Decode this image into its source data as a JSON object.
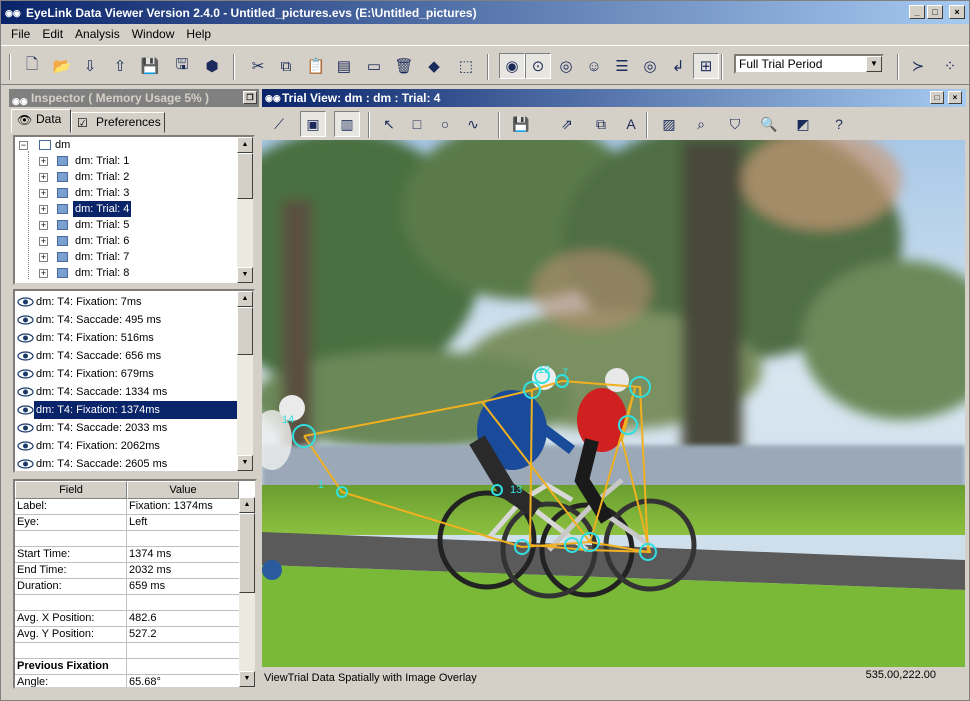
{
  "window": {
    "title": "EyeLink Data Viewer Version 2.4.0 - Untitled_pictures.evs (E:\\Untitled_pictures)",
    "icon": "eye-icon"
  },
  "menu": [
    "File",
    "Edit",
    "Analysis",
    "Window",
    "Help"
  ],
  "toolbar": {
    "period_select": "Full Trial Period",
    "buttons": [
      "new-document-icon",
      "open-folder-icon",
      "import-icon",
      "export-icon",
      "save-icon",
      "save-all-icon",
      "package-icon",
      "cut-icon",
      "copy-icon",
      "paste-icon",
      "clipboard-icon",
      "drive-icon",
      "delete-icon",
      "eraser-icon",
      "select-region-icon",
      "eye-icon",
      "eye-path-icon",
      "eye-closed-icon",
      "eye-person-icon",
      "report-icon",
      "target-icon",
      "input-icon",
      "grid-icon",
      "terminal-icon",
      "scatter-icon"
    ]
  },
  "inspector": {
    "title": "Inspector ( Memory Usage 5% )",
    "tabs": {
      "data": "Data",
      "preferences": "Preferences"
    },
    "tree": {
      "root": "dm",
      "items": [
        "dm: Trial: 1",
        "dm: Trial: 2",
        "dm: Trial: 3",
        "dm: Trial: 4",
        "dm: Trial: 5",
        "dm: Trial: 6",
        "dm: Trial: 7",
        "dm: Trial: 8"
      ],
      "selected": 3
    },
    "events": {
      "items": [
        "dm: T4: Fixation: 7ms",
        "dm: T4: Saccade: 495 ms",
        "dm: T4: Fixation: 516ms",
        "dm: T4: Saccade: 656 ms",
        "dm: T4: Fixation: 679ms",
        "dm: T4: Saccade: 1334 ms",
        "dm: T4: Fixation: 1374ms",
        "dm: T4: Saccade: 2033 ms",
        "dm: T4: Fixation: 2062ms",
        "dm: T4: Saccade: 2605 ms"
      ],
      "selected": 6
    },
    "properties": {
      "headers": {
        "field": "Field",
        "value": "Value"
      },
      "rows": [
        {
          "k": "Label:",
          "v": "Fixation: 1374ms"
        },
        {
          "k": "Eye:",
          "v": "Left"
        },
        {
          "k": "",
          "v": ""
        },
        {
          "k": "Start Time:",
          "v": "1374 ms"
        },
        {
          "k": "End Time:",
          "v": "2032 ms"
        },
        {
          "k": "Duration:",
          "v": "659 ms"
        },
        {
          "k": "",
          "v": ""
        },
        {
          "k": "Avg. X Position:",
          "v": "482.6"
        },
        {
          "k": "Avg. Y Position:",
          "v": "527.2"
        },
        {
          "k": "",
          "v": ""
        },
        {
          "k": "Previous Fixation",
          "v": "",
          "bold": true
        },
        {
          "k": "Angle:",
          "v": "65.68°"
        }
      ]
    }
  },
  "trial_view": {
    "title": "Trial View: dm : dm : Trial: 4",
    "status": "ViewTrial Data Spatially with Image Overlay",
    "cursor_coords": "535.00,222.00",
    "colors": {
      "saccade": "#f0b020",
      "fixation": "#30e0e0"
    },
    "labels": [
      "1",
      "14",
      "12",
      "13",
      "7"
    ],
    "toolbar_buttons": [
      "line-chart-icon",
      "image-icon",
      "film-icon",
      "pointer-icon",
      "rectangle-icon",
      "ellipse-icon",
      "freehand-icon",
      "save-icon",
      "image-export-icon",
      "copy-image-icon",
      "text-icon",
      "picture-icon",
      "zoom-region-icon",
      "shield-icon",
      "search-icon",
      "background-icon",
      "help-icon"
    ]
  }
}
